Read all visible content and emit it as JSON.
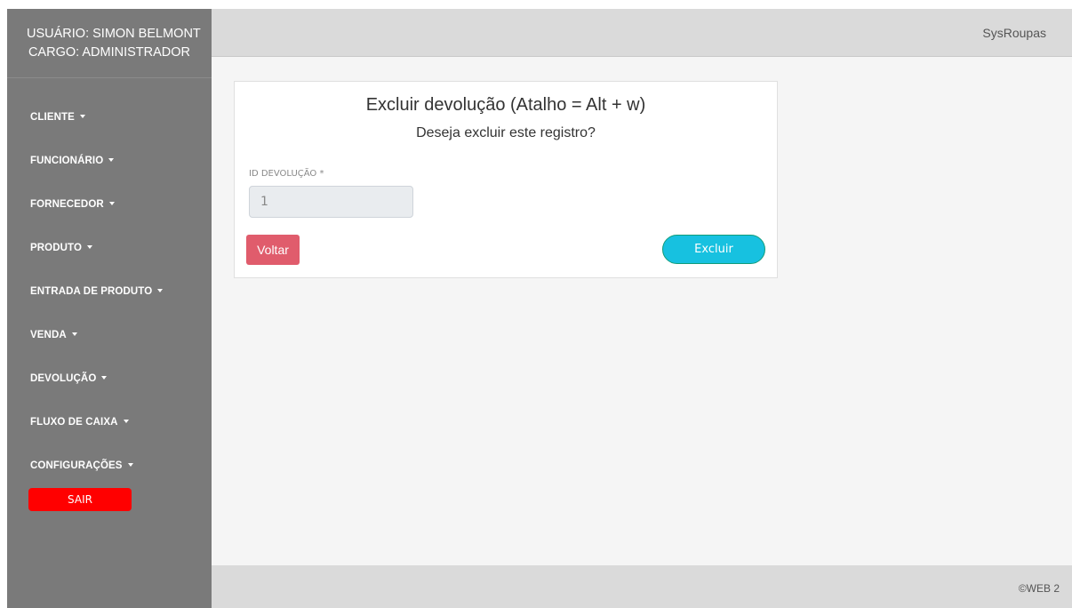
{
  "user": {
    "name_line": "USUÁRIO: SIMON BELMONT",
    "role_line": "CARGO: ADMINISTRADOR"
  },
  "sidebar": {
    "items": [
      {
        "label": "CLIENTE"
      },
      {
        "label": "FUNCIONÁRIO"
      },
      {
        "label": "FORNECEDOR"
      },
      {
        "label": "PRODUTO"
      },
      {
        "label": "ENTRADA DE PRODUTO"
      },
      {
        "label": "VENDA"
      },
      {
        "label": "DEVOLUÇÃO"
      },
      {
        "label": "FLUXO DE CAIXA"
      },
      {
        "label": "CONFIGURAÇÕES"
      }
    ],
    "logout_label": "SAIR"
  },
  "header": {
    "brand": "SysRoupas"
  },
  "dialog": {
    "title": "Excluir devolução (Atalho = Alt + w)",
    "subtitle": "Deseja excluir este registro?",
    "field_label": "ID DEVOLUÇÃO *",
    "field_value": "1",
    "back_label": "Voltar",
    "delete_label": "Excluir"
  },
  "footer": {
    "copyright": "©WEB 2"
  },
  "colors": {
    "sidebar_bg": "#7a7a7a",
    "logout_red": "#ff0000",
    "back_button": "#e05c6c",
    "delete_button": "#17c1e0"
  }
}
